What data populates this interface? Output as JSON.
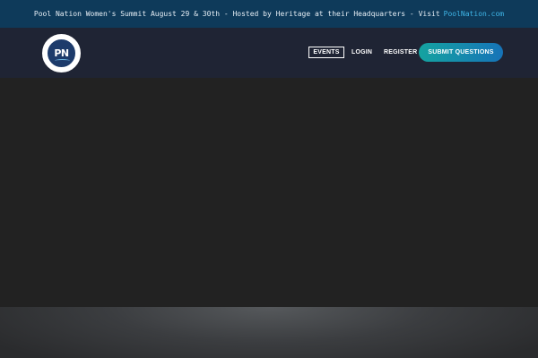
{
  "announcement": {
    "text": "Pool Nation Women's Summit August 29 & 30th - Hosted by Heritage at their Headquarters - Visit",
    "link_text": "PoolNation.com"
  },
  "logo": {
    "text": "PN"
  },
  "nav": {
    "events": "EVENTS",
    "login": "LOGIN",
    "register": "REGISTER",
    "cta": "SUBMIT QUESTIONS"
  },
  "colors": {
    "announcement_bg": "#0e3a5a",
    "header_bg": "#1f2434",
    "page_bg": "#222222",
    "link": "#3fb6e8",
    "cta_start": "#15a3a0",
    "cta_end": "#1673b8"
  }
}
